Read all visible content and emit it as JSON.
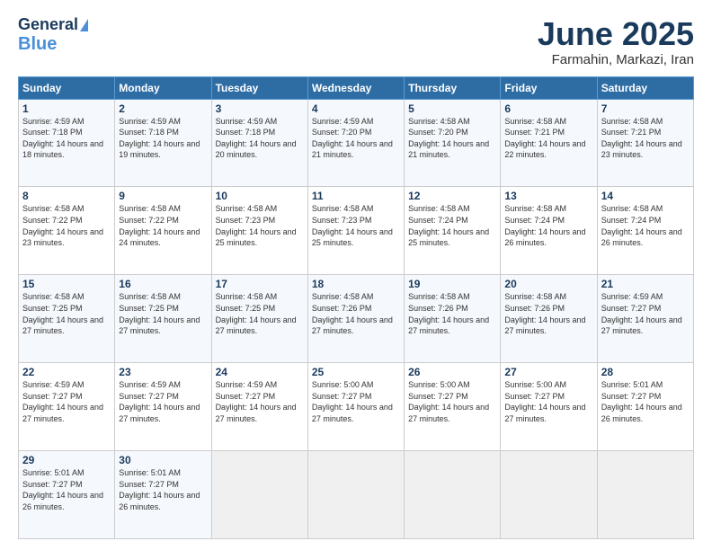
{
  "header": {
    "logo_line1": "General",
    "logo_line2": "Blue",
    "month": "June 2025",
    "location": "Farmahin, Markazi, Iran"
  },
  "weekdays": [
    "Sunday",
    "Monday",
    "Tuesday",
    "Wednesday",
    "Thursday",
    "Friday",
    "Saturday"
  ],
  "weeks": [
    [
      {
        "day": "1",
        "sunrise": "4:59 AM",
        "sunset": "7:18 PM",
        "daylight": "14 hours and 18 minutes."
      },
      {
        "day": "2",
        "sunrise": "4:59 AM",
        "sunset": "7:18 PM",
        "daylight": "14 hours and 19 minutes."
      },
      {
        "day": "3",
        "sunrise": "4:59 AM",
        "sunset": "7:18 PM",
        "daylight": "14 hours and 20 minutes."
      },
      {
        "day": "4",
        "sunrise": "4:59 AM",
        "sunset": "7:20 PM",
        "daylight": "14 hours and 21 minutes."
      },
      {
        "day": "5",
        "sunrise": "4:58 AM",
        "sunset": "7:20 PM",
        "daylight": "14 hours and 21 minutes."
      },
      {
        "day": "6",
        "sunrise": "4:58 AM",
        "sunset": "7:21 PM",
        "daylight": "14 hours and 22 minutes."
      },
      {
        "day": "7",
        "sunrise": "4:58 AM",
        "sunset": "7:21 PM",
        "daylight": "14 hours and 23 minutes."
      }
    ],
    [
      {
        "day": "8",
        "sunrise": "4:58 AM",
        "sunset": "7:22 PM",
        "daylight": "14 hours and 23 minutes."
      },
      {
        "day": "9",
        "sunrise": "4:58 AM",
        "sunset": "7:22 PM",
        "daylight": "14 hours and 24 minutes."
      },
      {
        "day": "10",
        "sunrise": "4:58 AM",
        "sunset": "7:23 PM",
        "daylight": "14 hours and 25 minutes."
      },
      {
        "day": "11",
        "sunrise": "4:58 AM",
        "sunset": "7:23 PM",
        "daylight": "14 hours and 25 minutes."
      },
      {
        "day": "12",
        "sunrise": "4:58 AM",
        "sunset": "7:24 PM",
        "daylight": "14 hours and 25 minutes."
      },
      {
        "day": "13",
        "sunrise": "4:58 AM",
        "sunset": "7:24 PM",
        "daylight": "14 hours and 26 minutes."
      },
      {
        "day": "14",
        "sunrise": "4:58 AM",
        "sunset": "7:24 PM",
        "daylight": "14 hours and 26 minutes."
      }
    ],
    [
      {
        "day": "15",
        "sunrise": "4:58 AM",
        "sunset": "7:25 PM",
        "daylight": "14 hours and 27 minutes."
      },
      {
        "day": "16",
        "sunrise": "4:58 AM",
        "sunset": "7:25 PM",
        "daylight": "14 hours and 27 minutes."
      },
      {
        "day": "17",
        "sunrise": "4:58 AM",
        "sunset": "7:25 PM",
        "daylight": "14 hours and 27 minutes."
      },
      {
        "day": "18",
        "sunrise": "4:58 AM",
        "sunset": "7:26 PM",
        "daylight": "14 hours and 27 minutes."
      },
      {
        "day": "19",
        "sunrise": "4:58 AM",
        "sunset": "7:26 PM",
        "daylight": "14 hours and 27 minutes."
      },
      {
        "day": "20",
        "sunrise": "4:58 AM",
        "sunset": "7:26 PM",
        "daylight": "14 hours and 27 minutes."
      },
      {
        "day": "21",
        "sunrise": "4:59 AM",
        "sunset": "7:27 PM",
        "daylight": "14 hours and 27 minutes."
      }
    ],
    [
      {
        "day": "22",
        "sunrise": "4:59 AM",
        "sunset": "7:27 PM",
        "daylight": "14 hours and 27 minutes."
      },
      {
        "day": "23",
        "sunrise": "4:59 AM",
        "sunset": "7:27 PM",
        "daylight": "14 hours and 27 minutes."
      },
      {
        "day": "24",
        "sunrise": "4:59 AM",
        "sunset": "7:27 PM",
        "daylight": "14 hours and 27 minutes."
      },
      {
        "day": "25",
        "sunrise": "5:00 AM",
        "sunset": "7:27 PM",
        "daylight": "14 hours and 27 minutes."
      },
      {
        "day": "26",
        "sunrise": "5:00 AM",
        "sunset": "7:27 PM",
        "daylight": "14 hours and 27 minutes."
      },
      {
        "day": "27",
        "sunrise": "5:00 AM",
        "sunset": "7:27 PM",
        "daylight": "14 hours and 27 minutes."
      },
      {
        "day": "28",
        "sunrise": "5:01 AM",
        "sunset": "7:27 PM",
        "daylight": "14 hours and 26 minutes."
      }
    ],
    [
      {
        "day": "29",
        "sunrise": "5:01 AM",
        "sunset": "7:27 PM",
        "daylight": "14 hours and 26 minutes."
      },
      {
        "day": "30",
        "sunrise": "5:01 AM",
        "sunset": "7:27 PM",
        "daylight": "14 hours and 26 minutes."
      },
      null,
      null,
      null,
      null,
      null
    ]
  ]
}
